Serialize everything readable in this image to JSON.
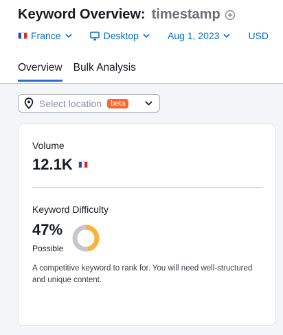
{
  "header": {
    "title": "Keyword Overview:",
    "keyword": "timestamp",
    "filters": {
      "country": "France",
      "device": "Desktop",
      "date": "Aug 1, 2023",
      "currency": "USD"
    },
    "tabs": [
      "Overview",
      "Bulk Analysis"
    ]
  },
  "location": {
    "placeholder": "Select location",
    "badge": "beta"
  },
  "card": {
    "volume_label": "Volume",
    "volume_value": "12.1K",
    "kd_label": "Keyword Difficulty",
    "kd_value": "47%",
    "kd_level": "Possible",
    "kd_percent": 47,
    "kd_description": "A competitive keyword to rank for. You will need well-structured and unique content."
  },
  "colors": {
    "link": "#006dca",
    "tab_underline": "#2b6cd4",
    "badge": "#ff642d",
    "kd_fill": "#f8b43f",
    "kd_track": "#c4c7cf"
  },
  "icons": {
    "add": "add-icon",
    "flag": "france-flag-icon",
    "device": "desktop-icon",
    "pin": "location-pin-icon",
    "chevron": "chevron-down-icon"
  }
}
